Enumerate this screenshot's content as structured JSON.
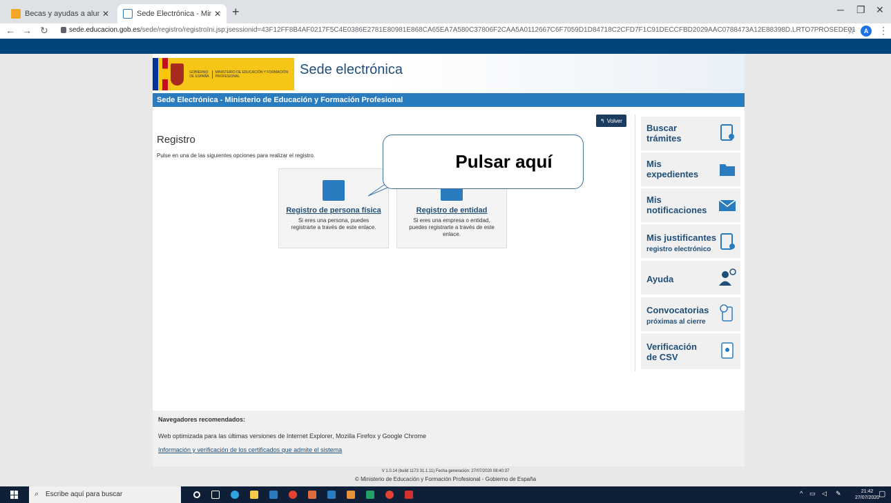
{
  "browser": {
    "tabs": [
      {
        "title": "Becas y ayudas a alumnos de niv",
        "active": false
      },
      {
        "title": "Sede Electrónica - Ministerio de",
        "active": true
      }
    ],
    "url_host": "sede.educacion.gob.es",
    "url_path": "/sede/registro/registroIni.jsp;jsessionid=43F12FF8B4AF0217F5C4E0386E2781E80981E868CA65EA7A580C37806F2CAA5A0112667C6F7059D1D84718C2CFD7F1C91DECCFBD2029AAC0788473A12E88398D.LRTO7PROSEDE01",
    "profile_initial": "A"
  },
  "header": {
    "logo_gobierno": "GOBIERNO DE ESPAÑA",
    "logo_ministerio": "MINISTERIO DE EDUCACIÓN Y FORMACIÓN PROFESIONAL",
    "site_title": "Sede electrónica",
    "band_title": "Sede Electrónica - Ministerio de Educación y Formación Profesional"
  },
  "main": {
    "volver": "Volver",
    "heading": "Registro",
    "lead": "Pulse en una de las siguientes opciones para realizar el registro.",
    "cards": [
      {
        "link": "Registro de persona física",
        "desc": "Si eres una persona, puedes registrarte a través de este enlace."
      },
      {
        "link": "Registro de entidad",
        "desc": "Si eres una empresa o entidad, puedes registrarte a través de este enlace."
      }
    ],
    "callout": "Pulsar aquí"
  },
  "sidebar": [
    {
      "label": "Buscar trámites",
      "sub": "",
      "icon": "search-document-icon"
    },
    {
      "label": "Mis expedientes",
      "sub": "",
      "icon": "folder-search-icon"
    },
    {
      "label": "Mis notificaciones",
      "sub": "",
      "icon": "envelope-icon"
    },
    {
      "label": "Mis justificantes",
      "sub": "registro electrónico",
      "icon": "document-download-icon"
    },
    {
      "label": "Ayuda",
      "sub": "",
      "icon": "help-user-icon"
    },
    {
      "label": "Convocatorias",
      "sub": "próximas al cierre",
      "icon": "calendar-document-icon"
    },
    {
      "label": "Verificación de CSV",
      "sub": "",
      "icon": "csv-document-icon"
    }
  ],
  "footer": {
    "title": "Navegadores recomendados:",
    "line": "Web optimizada para las últimas versiones de Internet Explorer, Mozilla Firefox y Google Chrome",
    "link": "Información y verificación de los certificados que admite el sistema",
    "version": "V 1.0.14 (build 1173 31.1.11) Fecha generación: 27/07/2020 08:40:37",
    "copyright": "© Ministerio de Educación y Formación Profesional - Gobierno de España"
  },
  "taskbar": {
    "search_placeholder": "Escribe aquí para buscar",
    "time": "21:42",
    "date": "27/07/2020"
  }
}
